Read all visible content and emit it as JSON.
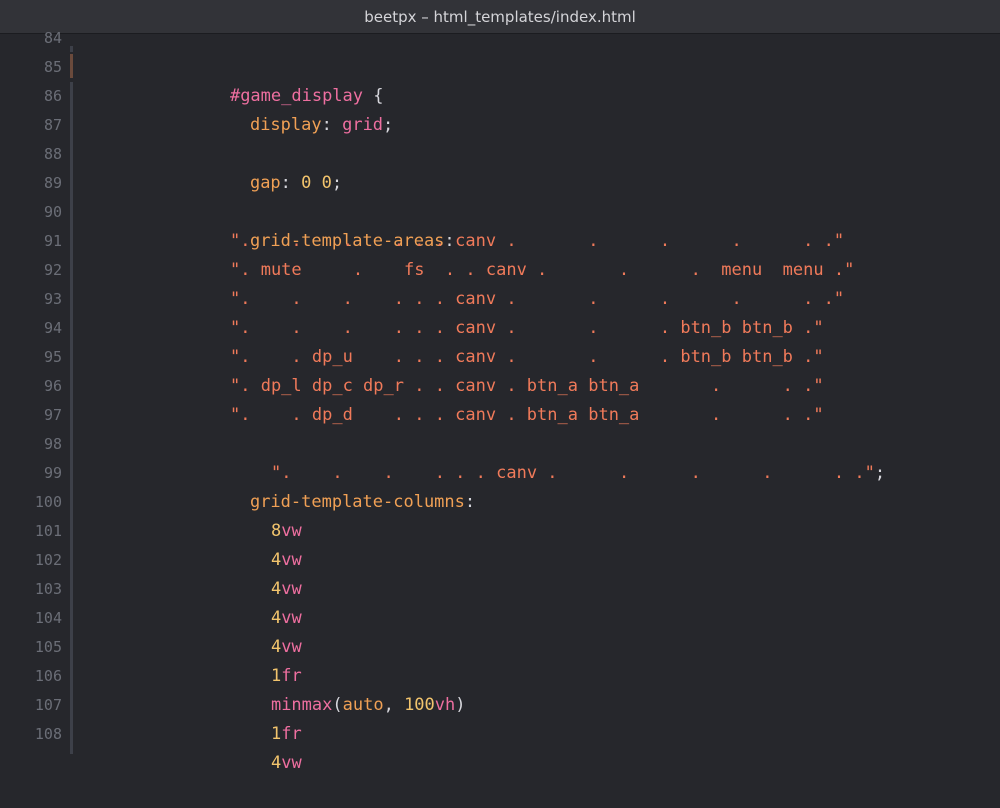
{
  "window": {
    "title": "beetpx – html_templates/index.html"
  },
  "colors": {
    "background": "#26272c",
    "titlebar": "#323338",
    "selector": "#ee6fa0",
    "property": "#f0a055",
    "number": "#f2c46d",
    "string": "#f07a5a",
    "line_number": "#6b6e77"
  },
  "editor": {
    "line_numbers": [
      "84",
      "85",
      "86",
      "87",
      "88",
      "89",
      "90",
      "91",
      "92",
      "93",
      "94",
      "95",
      "96",
      "97",
      "98",
      "99",
      "100",
      "101",
      "102",
      "103",
      "104",
      "105",
      "106",
      "107",
      "108"
    ],
    "lines": {
      "l85": {
        "selector": "#game_display",
        "brace": " {"
      },
      "l86": {
        "prop": "display",
        "colon": ": ",
        "value": "grid",
        "semi": ";"
      },
      "l88": {
        "prop": "gap",
        "colon": ": ",
        "value": "0 0",
        "semi": ";"
      },
      "l90": {
        "prop": "grid-template-areas",
        "colon": ":"
      },
      "l91": {
        "text": "\".    .    .    . . . canv .       .      .      .      . .\""
      },
      "l92": {
        "text": "\". mute     .    fs  . . canv .       .      .  menu  menu .\""
      },
      "l93": {
        "text": "\".    .    .    . . . canv .       .      .      .      . .\""
      },
      "l94": {
        "text": "\".    .    .    . . . canv .       .      . btn_b btn_b .\""
      },
      "l95": {
        "text": "\".    . dp_u    . . . canv .       .      . btn_b btn_b .\""
      },
      "l96": {
        "text": "\". dp_l dp_c dp_r . . canv . btn_a btn_a       .      . .\""
      },
      "l97": {
        "text": "\".    . dp_d    . . . canv . btn_a btn_a       .      . .\""
      },
      "l98": {
        "text": "\".    .    .    . . . canv .      .      .      .      . .\"",
        "semi": ";"
      },
      "l99": {
        "prop": "grid-template-columns",
        "colon": ":"
      },
      "l100": {
        "num": "8",
        "unit": "vw"
      },
      "l101": {
        "num": "4",
        "unit": "vw"
      },
      "l102": {
        "num": "4",
        "unit": "vw"
      },
      "l103": {
        "num": "4",
        "unit": "vw"
      },
      "l104": {
        "num": "4",
        "unit": "vw"
      },
      "l105": {
        "num": "1",
        "unit": "fr"
      },
      "l106": {
        "fn": "minmax",
        "open": "(",
        "arg1": "auto",
        "comma": ", ",
        "arg2num": "100",
        "arg2unit": "vh",
        "close": ")"
      },
      "l107": {
        "num": "1",
        "unit": "fr"
      },
      "l108": {
        "num": "4",
        "unit": "vw"
      }
    }
  }
}
